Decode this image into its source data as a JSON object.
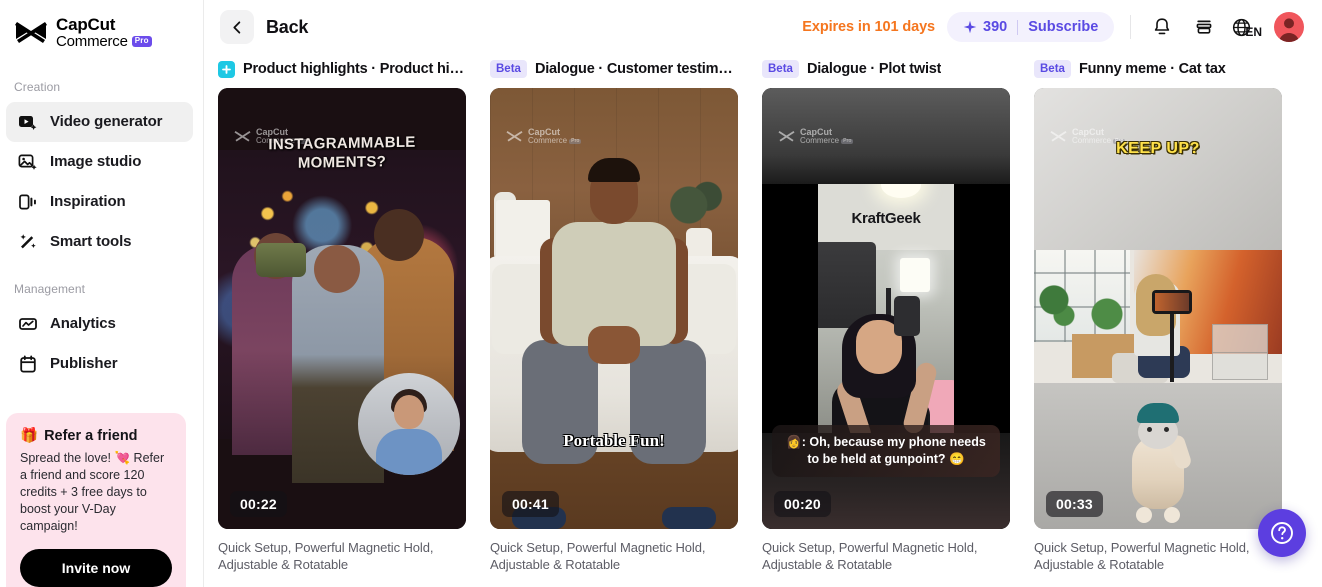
{
  "brand": {
    "name_line1": "CapCut",
    "name_line2": "Commerce",
    "pro_tag": "Pro"
  },
  "sidebar": {
    "sections": [
      {
        "label": "Creation"
      },
      {
        "label": "Management"
      }
    ],
    "creation_items": [
      {
        "label": "Video generator",
        "icon": "video-generator-icon",
        "active": true
      },
      {
        "label": "Image studio",
        "icon": "image-studio-icon",
        "active": false
      },
      {
        "label": "Inspiration",
        "icon": "inspiration-icon",
        "active": false
      },
      {
        "label": "Smart tools",
        "icon": "smart-tools-icon",
        "active": false
      }
    ],
    "management_items": [
      {
        "label": "Analytics",
        "icon": "analytics-icon",
        "active": false
      },
      {
        "label": "Publisher",
        "icon": "publisher-icon",
        "active": false
      }
    ],
    "refer": {
      "emoji": "🎁",
      "title": "Refer a friend",
      "body": "Spread the love! 💘 Refer a friend and score 120 credits + 3 free days to boost your V-Day campaign!",
      "button": "Invite now"
    }
  },
  "topbar": {
    "back_label": "Back",
    "expiry": "Expires in 101 days",
    "credits": "390",
    "subscribe": "Subscribe",
    "language": "EN",
    "icons": {
      "notification": "bell-icon",
      "archive": "archive-icon",
      "language": "globe-icon",
      "avatar": "user-avatar"
    }
  },
  "cards": [
    {
      "badge_type": "plus",
      "badge_label": "",
      "title": "Product highlights · Product highl…",
      "duration": "00:22",
      "overlay_text": "INSTAGRAMMABLE MOMENTS?",
      "subtitle": "",
      "description": "Quick Setup, Powerful Magnetic Hold, Adjustable & Rotatable"
    },
    {
      "badge_type": "beta",
      "badge_label": "Beta",
      "title": "Dialogue · Customer testimonial",
      "duration": "00:41",
      "overlay_text": "Portable Fun!",
      "subtitle": "",
      "description": "Quick Setup, Powerful Magnetic Hold, Adjustable & Rotatable"
    },
    {
      "badge_type": "beta",
      "badge_label": "Beta",
      "title": "Dialogue · Plot twist",
      "duration": "00:20",
      "overlay_text": "KraftGeek",
      "subtitle": "👩: Oh, because my phone needs to be held at gunpoint? 😁",
      "description": "Quick Setup, Powerful Magnetic Hold, Adjustable & Rotatable"
    },
    {
      "badge_type": "beta",
      "badge_label": "Beta",
      "title": "Funny meme · Cat tax",
      "duration": "00:33",
      "overlay_text": "KEEP UP?",
      "subtitle": "",
      "description": "Quick Setup, Powerful Magnetic Hold, Adjustable & Rotatable"
    }
  ],
  "watermark": {
    "line1": "CapCut",
    "line2": "Commerce",
    "pro": "Pro"
  },
  "help": {
    "icon": "help-question-icon"
  },
  "colors": {
    "accent_purple": "#5a4ae3",
    "expiry_orange": "#f5761f",
    "plus_badge_cyan": "#1ec8e4",
    "refer_pink": "#fde3ec",
    "avatar_red": "#f0565c"
  }
}
